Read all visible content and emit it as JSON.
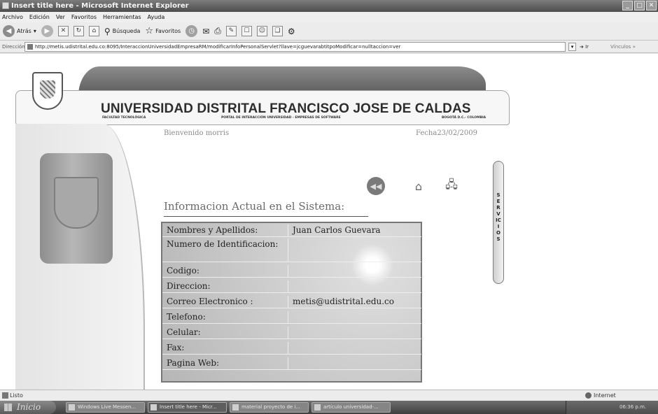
{
  "window": {
    "title": "Insert title here - Microsoft Internet Explorer"
  },
  "menu": [
    "Archivo",
    "Edición",
    "Ver",
    "Favoritos",
    "Herramientas",
    "Ayuda"
  ],
  "toolbar": {
    "back_label": "Atrás",
    "search_label": "Búsqueda",
    "favorites_label": "Favoritos"
  },
  "address": {
    "label": "Dirección",
    "url": "http://metis.udistrital.edu.co:8095/InteraccionUniversidadEmpresaRM/modificarInfoPersonalServlet?llave=jcguevarabtitpoModificar=nulltaccion=ver",
    "go_label": "Ir",
    "links_label": "Vínculos"
  },
  "header": {
    "university": "UNIVERSIDAD DISTRITAL FRANCISCO JOSE DE CALDAS",
    "faculty": "FACULTAD TECNOLÓGICA",
    "portal": "PORTAL DE INTERACCIÓN UNIVERSIDAD - EMPRESAS DE SOFTWARE",
    "city": "BOGOTÁ D.C.- COLOMBIA"
  },
  "page": {
    "welcome": "Bienvenido morris",
    "date": "Fecha23/02/2009",
    "section_title": "Informacion Actual en el Sistema:",
    "services_tab": "SERVICIOS"
  },
  "profile_table": {
    "rows": [
      {
        "label": "Nombres y Apellidos:",
        "value": "Juan Carlos Guevara"
      },
      {
        "label": "Numero de Identificacion:",
        "value": ""
      },
      {
        "label": "Codigo:",
        "value": ""
      },
      {
        "label": "Direccion:",
        "value": ""
      },
      {
        "label": "Correo Electronico :",
        "value": "metis@udistrital.edu.co"
      },
      {
        "label": "Telefono:",
        "value": ""
      },
      {
        "label": "Celular:",
        "value": ""
      },
      {
        "label": "Fax:",
        "value": ""
      },
      {
        "label": "Pagina Web:",
        "value": ""
      }
    ]
  },
  "statusbar": {
    "left": "Listo",
    "zone": "Internet"
  },
  "taskbar": {
    "start_label": "Inicio",
    "items": [
      "Windows Live Messen...",
      "Insert title here - Micr...",
      "material proyecto de i...",
      "artículo universidad-..."
    ],
    "clock": "06:36 p.m."
  },
  "icons": {
    "back": "back-arrow-icon",
    "home": "home-icon",
    "network": "network-icon"
  }
}
